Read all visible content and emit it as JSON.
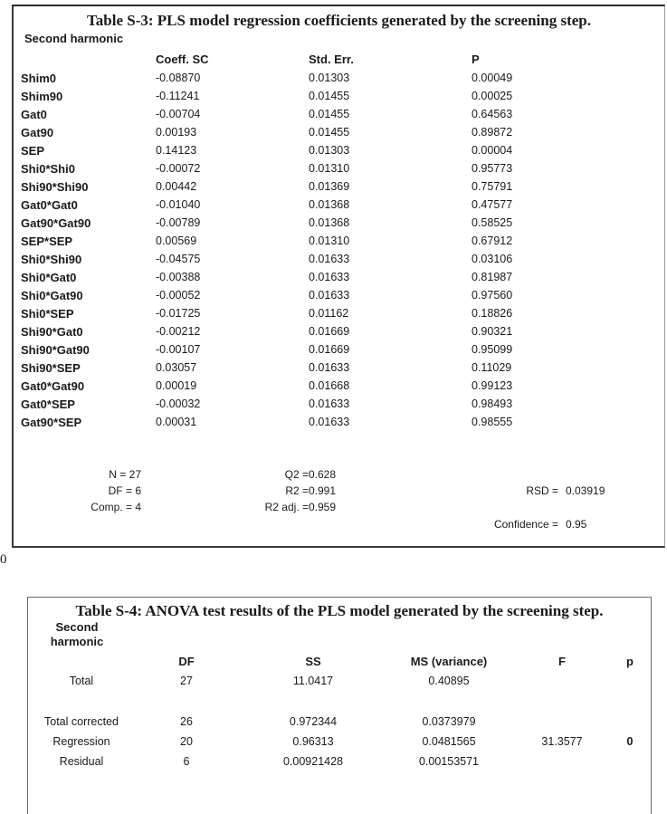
{
  "table_s3": {
    "title": "Table S-3: PLS model regression coefficients generated by the screening step.",
    "subheading": "Second harmonic",
    "columns": [
      "Coeff. SC",
      "Std. Err.",
      "P"
    ],
    "rows": [
      {
        "term": "Shim0",
        "coeff": "-0.08870",
        "std_err": "0.01303",
        "p": "0.00049"
      },
      {
        "term": "Shim90",
        "coeff": "-0.11241",
        "std_err": "0.01455",
        "p": "0.00025"
      },
      {
        "term": "Gat0",
        "coeff": "-0.00704",
        "std_err": "0.01455",
        "p": "0.64563"
      },
      {
        "term": "Gat90",
        "coeff": "0.00193",
        "std_err": "0.01455",
        "p": "0.89872"
      },
      {
        "term": "SEP",
        "coeff": "0.14123",
        "std_err": "0.01303",
        "p": "0.00004"
      },
      {
        "term": "Shi0*Shi0",
        "coeff": "-0.00072",
        "std_err": "0.01310",
        "p": "0.95773"
      },
      {
        "term": "Shi90*Shi90",
        "coeff": "0.00442",
        "std_err": "0.01369",
        "p": "0.75791"
      },
      {
        "term": "Gat0*Gat0",
        "coeff": "-0.01040",
        "std_err": "0.01368",
        "p": "0.47577"
      },
      {
        "term": "Gat90*Gat90",
        "coeff": "-0.00789",
        "std_err": "0.01368",
        "p": "0.58525"
      },
      {
        "term": "SEP*SEP",
        "coeff": "0.00569",
        "std_err": "0.01310",
        "p": "0.67912"
      },
      {
        "term": "Shi0*Shi90",
        "coeff": "-0.04575",
        "std_err": "0.01633",
        "p": "0.03106"
      },
      {
        "term": "Shi0*Gat0",
        "coeff": "-0.00388",
        "std_err": "0.01633",
        "p": "0.81987"
      },
      {
        "term": "Shi0*Gat90",
        "coeff": "-0.00052",
        "std_err": "0.01633",
        "p": "0.97560"
      },
      {
        "term": "Shi0*SEP",
        "coeff": "-0.01725",
        "std_err": "0.01162",
        "p": "0.18826"
      },
      {
        "term": "Shi90*Gat0",
        "coeff": "-0.00212",
        "std_err": "0.01669",
        "p": "0.90321"
      },
      {
        "term": "Shi90*Gat90",
        "coeff": "-0.00107",
        "std_err": "0.01669",
        "p": "0.95099"
      },
      {
        "term": "Shi90*SEP",
        "coeff": "0.03057",
        "std_err": "0.01633",
        "p": "0.11029"
      },
      {
        "term": "Gat0*Gat90",
        "coeff": "0.00019",
        "std_err": "0.01668",
        "p": "0.99123"
      },
      {
        "term": "Gat0*SEP",
        "coeff": "-0.00032",
        "std_err": "0.01633",
        "p": "0.98493"
      },
      {
        "term": "Gat90*SEP",
        "coeff": "0.00031",
        "std_err": "0.01633",
        "p": "0.98555"
      }
    ],
    "stats": {
      "n": "N = 27",
      "df": "DF = 6",
      "comp": "Comp. = 4",
      "q2_label": "Q2 =",
      "q2_value": "0.628",
      "r2_label": "R2 =",
      "r2_value": "0.991",
      "r2adj_label": "R2 adj. =",
      "r2adj_value": "0.959",
      "rsd_label": "RSD =",
      "rsd_value": "0.03919",
      "confidence_label": "Confidence =",
      "confidence_value": "0.95"
    }
  },
  "stray_text": "0",
  "table_s4": {
    "title": "Table S-4: ANOVA test results of the PLS model generated by the screening step.",
    "subheading": "Second harmonic",
    "columns": [
      "DF",
      "SS",
      "MS (variance)",
      "F",
      "p"
    ],
    "rows": [
      {
        "source": "Total",
        "df": "27",
        "ss": "11.0417",
        "ms": "0.40895",
        "f": "",
        "p": ""
      },
      {
        "source": "Total corrected",
        "df": "26",
        "ss": "0.972344",
        "ms": "0.0373979",
        "f": "",
        "p": ""
      },
      {
        "source": "Regression",
        "df": "20",
        "ss": "0.96313",
        "ms": "0.0481565",
        "f": "31.3577",
        "p": "0"
      },
      {
        "source": "Residual",
        "df": "6",
        "ss": "0.00921428",
        "ms": "0.00153571",
        "f": "",
        "p": ""
      }
    ]
  }
}
